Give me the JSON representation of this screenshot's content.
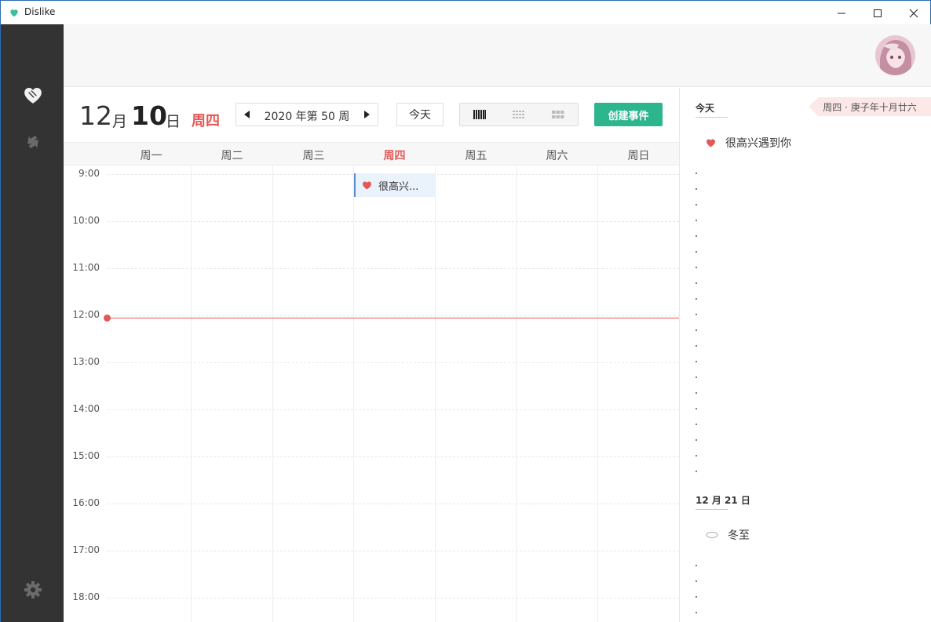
{
  "window": {
    "title": "Dislike",
    "controls": {
      "minimize": "minimize-icon",
      "maximize": "maximize-icon",
      "close": "close-icon"
    }
  },
  "sidebar": {
    "items": [
      {
        "name": "favorites",
        "icon": "heart-icon",
        "active": true
      },
      {
        "name": "sync",
        "icon": "sync-icon",
        "active": false
      },
      {
        "name": "settings",
        "icon": "gear-icon",
        "active": false
      }
    ]
  },
  "header": {
    "month_num": "12",
    "month_unit": "月",
    "day_num": "10",
    "day_unit": "日",
    "weekday": "周四",
    "week_label": "2020 年第 50 周",
    "today_label": "今天",
    "views": [
      "week-view",
      "month-view",
      "year-view"
    ],
    "create_label": "创建事件"
  },
  "week_days": [
    "周一",
    "周二",
    "周三",
    "周四",
    "周五",
    "周六",
    "周日"
  ],
  "today_index": 3,
  "hours": [
    "9:00",
    "10:00",
    "11:00",
    "12:00",
    "13:00",
    "14:00",
    "15:00",
    "16:00",
    "17:00",
    "18:00"
  ],
  "events": [
    {
      "day_index": 3,
      "start": "9:00",
      "title": "很高兴...",
      "icon": "heart-icon"
    }
  ],
  "right_panel": {
    "today_title": "今天",
    "lunar": "周四 · 庚子年十月廿六",
    "today_items": [
      {
        "icon": "heart-icon",
        "text": "很高兴遇到你"
      }
    ],
    "next_title": "12 月 21 日",
    "next_items": [
      {
        "icon": "leaf-icon",
        "text": "冬至"
      }
    ]
  },
  "colors": {
    "accent_red": "#e45757",
    "accent_green": "#2db58e",
    "sidebar_bg": "#333333",
    "event_bg": "#eaf2fb",
    "event_border": "#5a8fcf"
  }
}
